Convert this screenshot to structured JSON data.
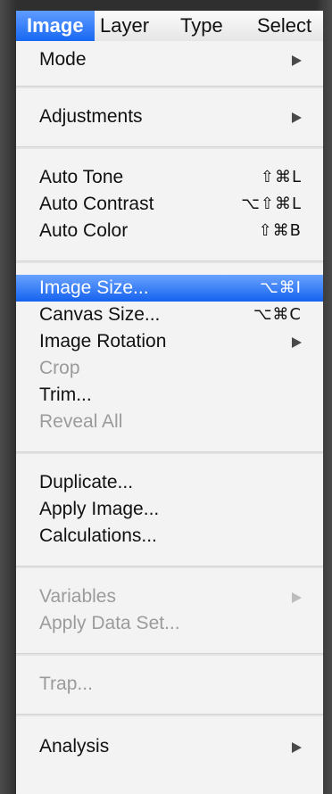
{
  "menubar": {
    "items": [
      "Image",
      "Layer",
      "Type",
      "Select"
    ]
  },
  "menu": {
    "items": [
      {
        "label": "Mode",
        "shortcut": "",
        "submenu": true,
        "disabled": false,
        "selected": false
      },
      {
        "label": "Adjustments",
        "shortcut": "",
        "submenu": true,
        "disabled": false,
        "selected": false
      },
      {
        "label": "Auto Tone",
        "shortcut": "⇧⌘L",
        "submenu": false,
        "disabled": false,
        "selected": false
      },
      {
        "label": "Auto Contrast",
        "shortcut": "⌥⇧⌘L",
        "submenu": false,
        "disabled": false,
        "selected": false
      },
      {
        "label": "Auto Color",
        "shortcut": "⇧⌘B",
        "submenu": false,
        "disabled": false,
        "selected": false
      },
      {
        "label": "Image Size...",
        "shortcut": "⌥⌘I",
        "submenu": false,
        "disabled": false,
        "selected": true
      },
      {
        "label": "Canvas Size...",
        "shortcut": "⌥⌘C",
        "submenu": false,
        "disabled": false,
        "selected": false
      },
      {
        "label": "Image Rotation",
        "shortcut": "",
        "submenu": true,
        "disabled": false,
        "selected": false
      },
      {
        "label": "Crop",
        "shortcut": "",
        "submenu": false,
        "disabled": true,
        "selected": false
      },
      {
        "label": "Trim...",
        "shortcut": "",
        "submenu": false,
        "disabled": false,
        "selected": false
      },
      {
        "label": "Reveal All",
        "shortcut": "",
        "submenu": false,
        "disabled": true,
        "selected": false
      },
      {
        "label": "Duplicate...",
        "shortcut": "",
        "submenu": false,
        "disabled": false,
        "selected": false
      },
      {
        "label": "Apply Image...",
        "shortcut": "",
        "submenu": false,
        "disabled": false,
        "selected": false
      },
      {
        "label": "Calculations...",
        "shortcut": "",
        "submenu": false,
        "disabled": false,
        "selected": false
      },
      {
        "label": "Variables",
        "shortcut": "",
        "submenu": true,
        "disabled": true,
        "selected": false
      },
      {
        "label": "Apply Data Set...",
        "shortcut": "",
        "submenu": false,
        "disabled": true,
        "selected": false
      },
      {
        "label": "Trap...",
        "shortcut": "",
        "submenu": false,
        "disabled": true,
        "selected": false
      },
      {
        "label": "Analysis",
        "shortcut": "",
        "submenu": true,
        "disabled": false,
        "selected": false
      }
    ]
  },
  "colors": {
    "highlight": "#1868f3",
    "disabled_text": "#9b9b9b",
    "menu_bg": "#f3f3f3"
  }
}
